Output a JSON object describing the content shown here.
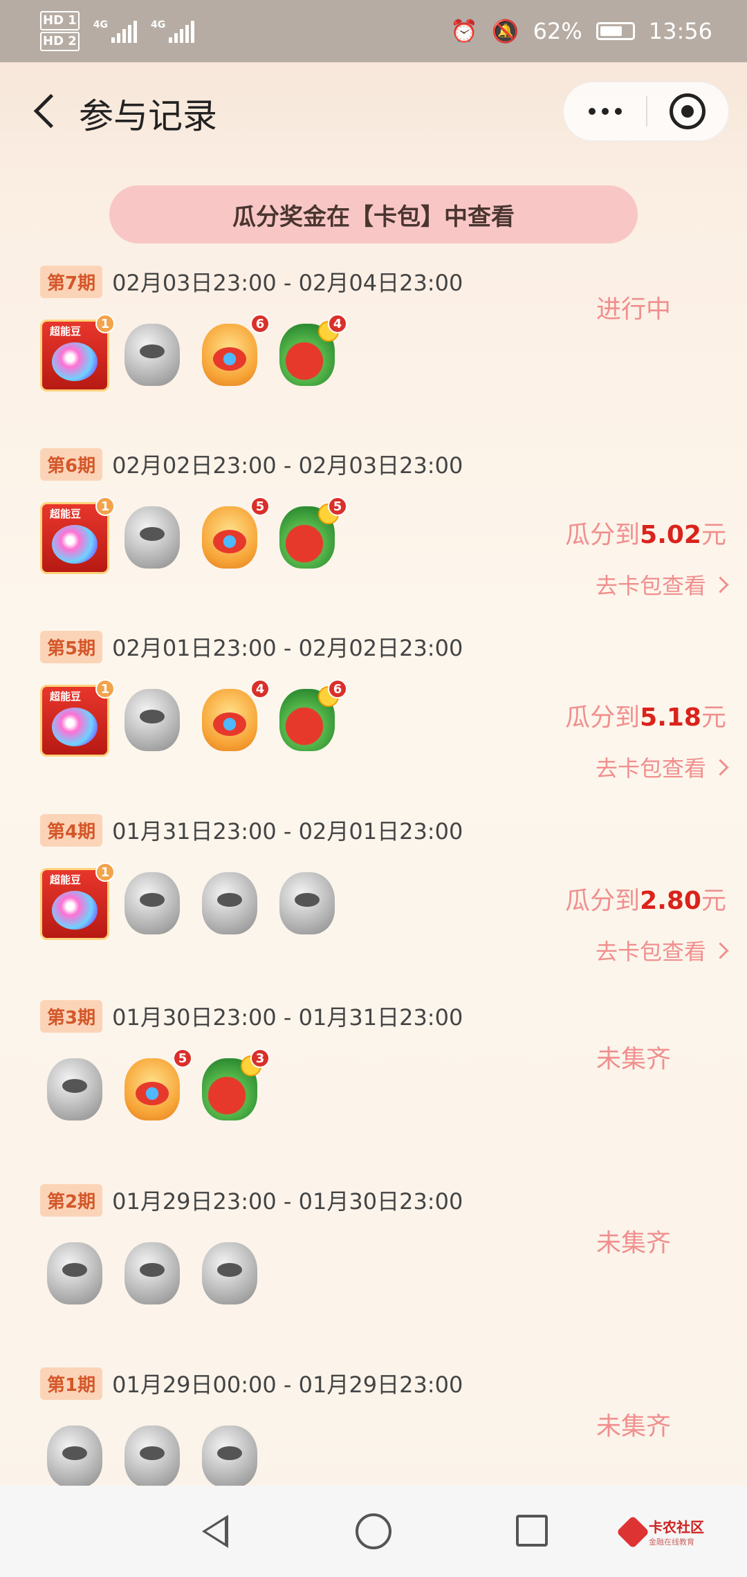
{
  "status_bar": {
    "hd1": "HD 1",
    "hd2": "HD 2",
    "net1": "4G",
    "net2": "4G",
    "battery": "62%",
    "time": "13:56"
  },
  "header": {
    "title": "参与记录"
  },
  "banner": {
    "text": "瓜分奖金在【卡包】中查看"
  },
  "records": [
    {
      "period": "第7期",
      "date_range": "02月03日23:00 - 02月04日23:00",
      "icons": [
        {
          "type": "super",
          "name": "super-bean-icon",
          "label": "超能豆",
          "count": "1"
        },
        {
          "type": "gray",
          "name": "gray-bean-icon",
          "count": ""
        },
        {
          "type": "orange",
          "name": "lucky-bean-icon",
          "count": "6"
        },
        {
          "type": "green",
          "name": "fortune-bean-icon",
          "count": "4"
        }
      ],
      "status": "进行中"
    },
    {
      "period": "第6期",
      "date_range": "02月02日23:00 - 02月03日23:00",
      "icons": [
        {
          "type": "super",
          "name": "super-bean-icon",
          "label": "超能豆",
          "count": "1"
        },
        {
          "type": "gray",
          "name": "gray-bean-icon",
          "count": ""
        },
        {
          "type": "orange",
          "name": "lucky-bean-icon",
          "count": "5"
        },
        {
          "type": "green",
          "name": "fortune-bean-icon",
          "count": "5"
        }
      ],
      "result_prefix": "瓜分到",
      "amount": "5.02",
      "result_suffix": "元",
      "link": "去卡包查看"
    },
    {
      "period": "第5期",
      "date_range": "02月01日23:00 - 02月02日23:00",
      "icons": [
        {
          "type": "super",
          "name": "super-bean-icon",
          "label": "超能豆",
          "count": "1"
        },
        {
          "type": "gray",
          "name": "gray-bean-icon",
          "count": ""
        },
        {
          "type": "orange",
          "name": "lucky-bean-icon",
          "count": "4"
        },
        {
          "type": "green",
          "name": "fortune-bean-icon",
          "count": "6"
        }
      ],
      "result_prefix": "瓜分到",
      "amount": "5.18",
      "result_suffix": "元",
      "link": "去卡包查看"
    },
    {
      "period": "第4期",
      "date_range": "01月31日23:00 - 02月01日23:00",
      "icons": [
        {
          "type": "super",
          "name": "super-bean-icon",
          "label": "超能豆",
          "count": "1"
        },
        {
          "type": "gray",
          "name": "gray-bean-icon",
          "count": ""
        },
        {
          "type": "gray",
          "name": "gray-bean-icon",
          "count": ""
        },
        {
          "type": "gray",
          "name": "gray-bean-icon",
          "count": ""
        }
      ],
      "result_prefix": "瓜分到",
      "amount": "2.80",
      "result_suffix": "元",
      "link": "去卡包查看"
    },
    {
      "period": "第3期",
      "date_range": "01月30日23:00 - 01月31日23:00",
      "icons": [
        {
          "type": "gray",
          "name": "gray-bean-icon",
          "count": ""
        },
        {
          "type": "orange",
          "name": "lucky-bean-icon",
          "count": "5"
        },
        {
          "type": "green",
          "name": "fortune-bean-icon",
          "count": "3"
        }
      ],
      "status": "未集齐"
    },
    {
      "period": "第2期",
      "date_range": "01月29日23:00 - 01月30日23:00",
      "icons": [
        {
          "type": "gray",
          "name": "gray-bean-icon",
          "count": ""
        },
        {
          "type": "gray",
          "name": "gray-bean-icon",
          "count": ""
        },
        {
          "type": "gray",
          "name": "gray-bean-icon",
          "count": ""
        }
      ],
      "status": "未集齐"
    },
    {
      "period": "第1期",
      "date_range": "01月29日00:00 - 01月29日23:00",
      "icons": [
        {
          "type": "gray",
          "name": "gray-bean-icon",
          "count": ""
        },
        {
          "type": "gray",
          "name": "gray-bean-icon",
          "count": ""
        },
        {
          "type": "gray",
          "name": "gray-bean-icon",
          "count": ""
        }
      ],
      "status": "未集齐"
    }
  ],
  "watermark": {
    "main": "卡农社区",
    "sub": "金融在线教育"
  }
}
